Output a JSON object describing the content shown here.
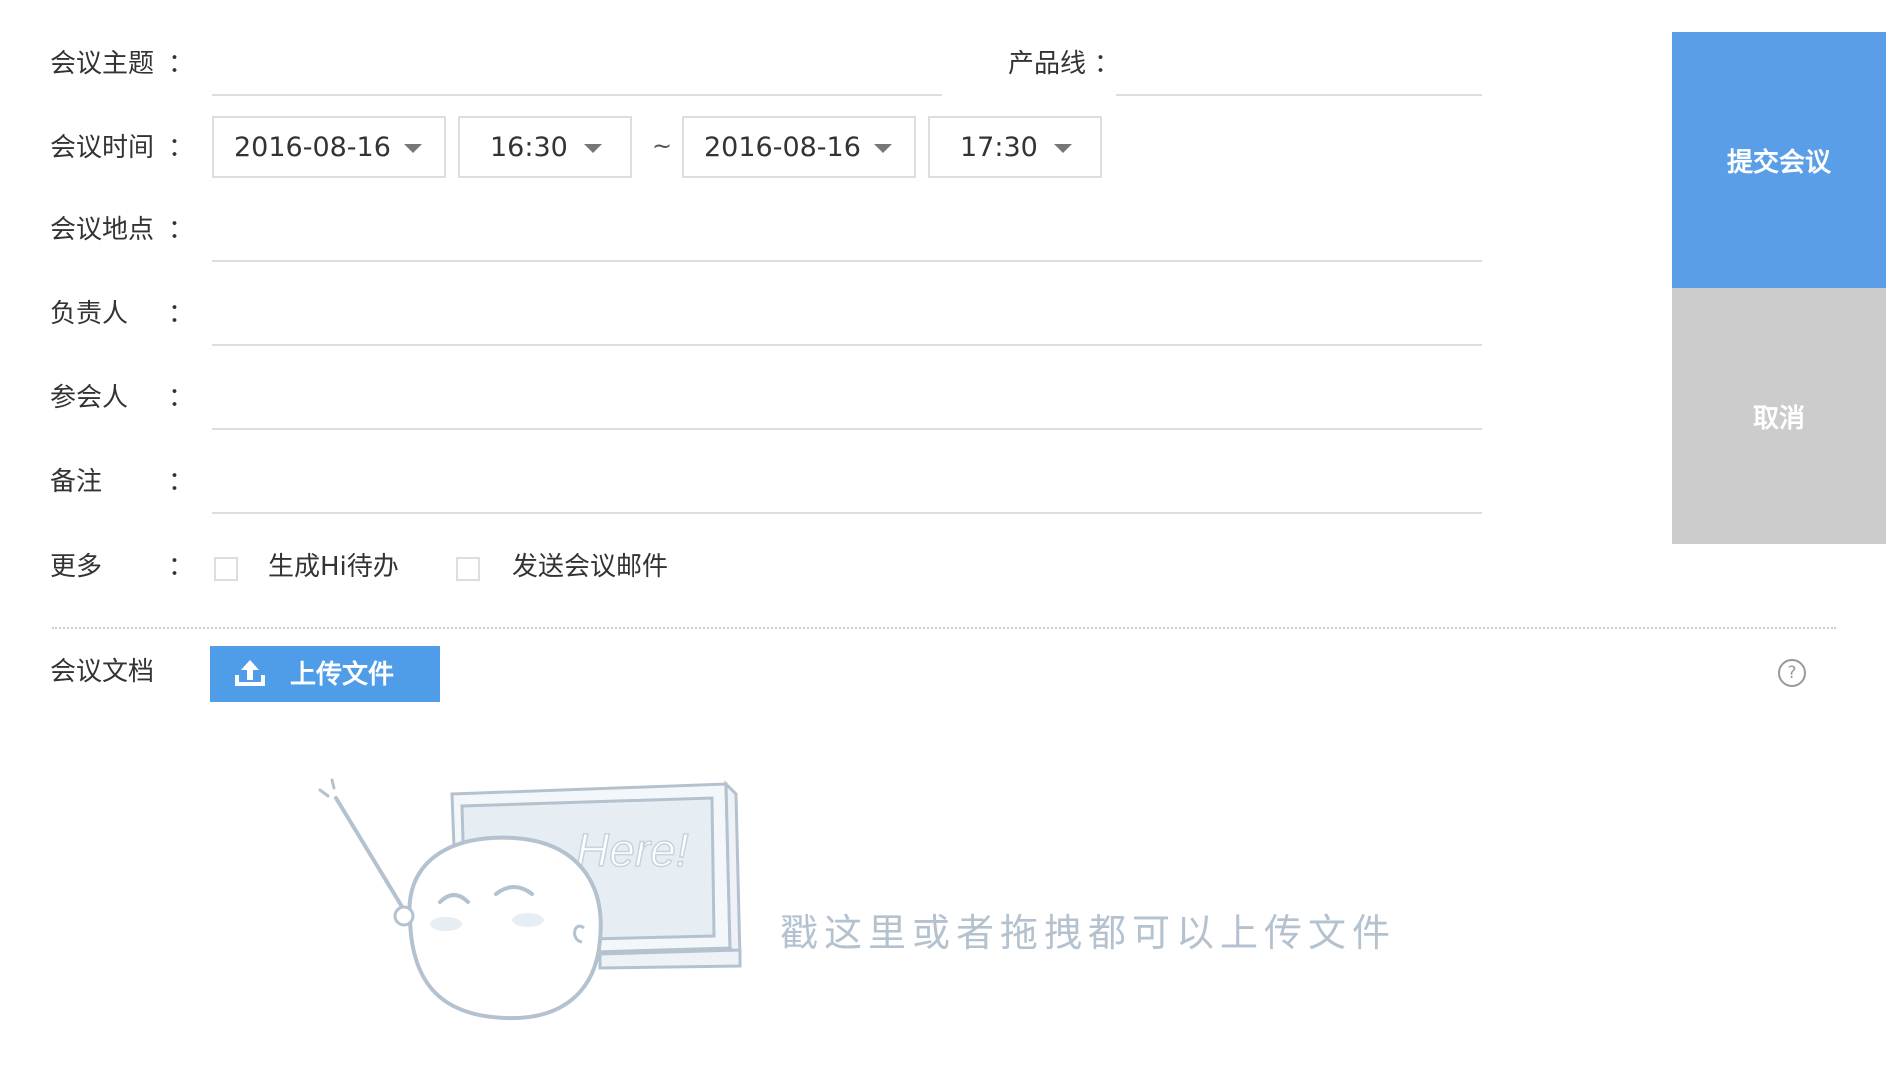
{
  "form": {
    "topic": {
      "label": "会议主题",
      "colon": "：",
      "value": ""
    },
    "product_line": {
      "label": "产品线",
      "colon": "：",
      "value": ""
    },
    "time": {
      "label": "会议时间",
      "colon": "：",
      "start_date": "2016-08-16",
      "start_time": "16:30",
      "separator": "~",
      "end_date": "2016-08-16",
      "end_time": "17:30"
    },
    "location": {
      "label": "会议地点",
      "colon": "：",
      "value": ""
    },
    "owner": {
      "label": "负责人",
      "colon": "：",
      "value": ""
    },
    "attendees": {
      "label": "参会人",
      "colon": "：",
      "value": ""
    },
    "notes": {
      "label": "备注",
      "colon": "：",
      "value": ""
    },
    "more": {
      "label": "更多",
      "colon": "：",
      "options": [
        {
          "label": "生成Hi待办",
          "checked": false
        },
        {
          "label": "发送会议邮件",
          "checked": false
        }
      ]
    }
  },
  "actions": {
    "submit_label": "提交会议",
    "cancel_label": "取消"
  },
  "documents": {
    "label": "会议文档",
    "upload_label": "上传文件",
    "help_glyph": "?",
    "drop_hint": "戳这里或者拖拽都可以上传文件",
    "board_text": "Here!"
  },
  "colors": {
    "submit_bg": "#5b9ee8",
    "cancel_bg": "#cccccc",
    "upload_bg": "#4f9de8",
    "illustration_stroke": "#b4c2cf"
  },
  "icons": {
    "upload": "upload-arrow-icon",
    "help": "question-circle-icon",
    "dropdown": "caret-down-icon",
    "illustration": "ghost-pointing-board-illustration"
  }
}
